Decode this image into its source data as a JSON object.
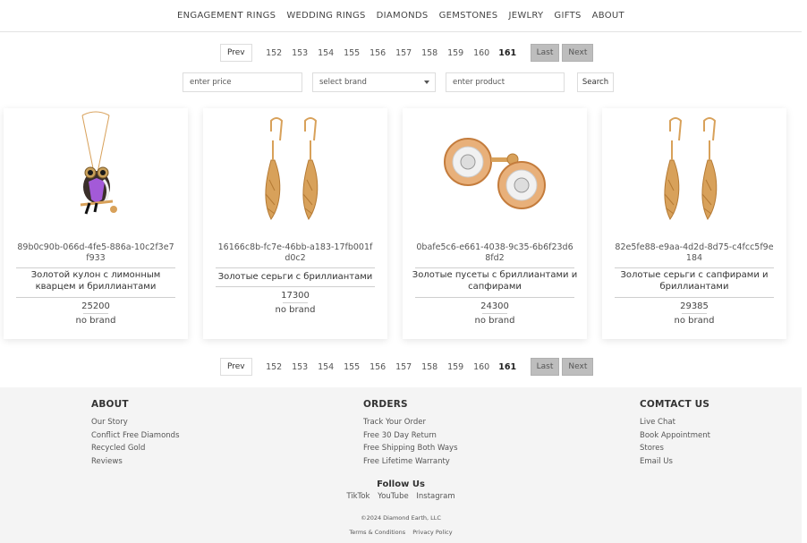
{
  "nav": {
    "items": [
      "ENGAGEMENT RINGS",
      "WEDDING RINGS",
      "DIAMONDS",
      "GEMSTONES",
      "JEWLRY",
      "GIFTS",
      "ABOUT"
    ]
  },
  "pager": {
    "prev": "Prev",
    "pages": [
      "152",
      "153",
      "154",
      "155",
      "156",
      "157",
      "158",
      "159",
      "160",
      "161"
    ],
    "current": "161",
    "last": "Last",
    "next": "Next"
  },
  "filters": {
    "price_placeholder": "enter price",
    "brand_selected": "select brand",
    "product_placeholder": "enter product",
    "search": "Search"
  },
  "products": [
    {
      "id": "89b0c90b-066d-4fe5-886a-10c2f3e7f933",
      "name": "Золотой кулон с лимонным кварцем и бриллиантами",
      "price": "25200",
      "brand": "no brand",
      "image": "owl-pendant"
    },
    {
      "id": "16166c8b-fc7e-46bb-a183-17fb001fd0c2",
      "name": "Золотые серьги с бриллиантами",
      "price": "17300",
      "brand": "no brand",
      "image": "drop-earrings"
    },
    {
      "id": "0bafe5c6-e661-4038-9c35-6b6f23d68fd2",
      "name": "Золотые пусеты с бриллиантами и сапфирами",
      "price": "24300",
      "brand": "no brand",
      "image": "stud-earrings"
    },
    {
      "id": "82e5fe88-e9aa-4d2d-8d75-c4fcc5f9e184",
      "name": "Золотые серьги с сапфирами и бриллиантами",
      "price": "29385",
      "brand": "no brand",
      "image": "drop-earrings"
    }
  ],
  "footer": {
    "about": {
      "title": "ABOUT",
      "links": [
        "Our Story",
        "Conflict Free Diamonds",
        "Recycled Gold",
        "Reviews"
      ]
    },
    "orders": {
      "title": "ORDERS",
      "links": [
        "Track Your Order",
        "Free 30 Day Return",
        "Free Shipping Both Ways",
        "Free Lifetime Warranty"
      ]
    },
    "contact": {
      "title": "COMTACT US",
      "links": [
        "Live Chat",
        "Book Appointment",
        "Stores",
        "Email Us"
      ]
    },
    "follow": {
      "title": "Follow Us",
      "links": [
        "TikTok",
        "YouTube",
        "Instagram"
      ]
    },
    "copyright": "©2024 Diamond Earth, LLC",
    "legal": [
      "Terms & Conditions",
      "Privacy Policy"
    ]
  },
  "colors": {
    "gold": "#d8a15a",
    "gold_dark": "#b57a34",
    "pager_gray": "#bdbdbd",
    "footer_bg": "#f4f4f4"
  }
}
